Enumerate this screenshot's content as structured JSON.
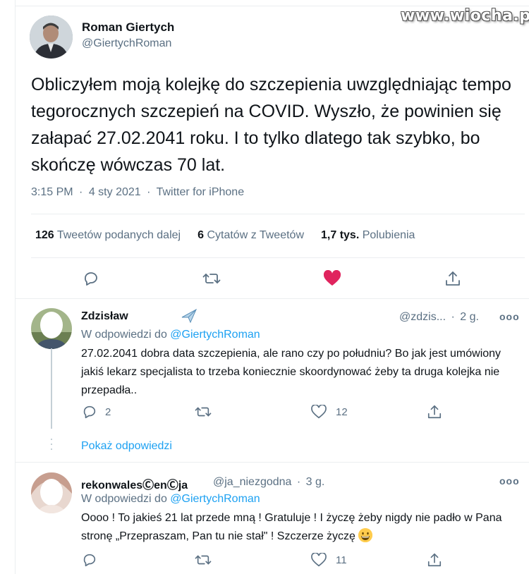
{
  "watermark": "www.wiocha.pl",
  "tweet": {
    "author_name": "Roman Giertych",
    "author_handle": "@GiertychRoman",
    "text": "Obliczyłem moją kolejkę do szczepienia uwzględniając tempo tegorocznych szczepień na COVID. Wyszło, że powinien się załapać 27.02.2041 roku. I to tylko dlatego tak szybko, bo skończę wówczas 70 lat.",
    "time": "3:15 PM",
    "date": "4 sty 2021",
    "source": "Twitter for iPhone",
    "stats": {
      "retweets_count": "126",
      "retweets_label": "Tweetów podanych dalej",
      "quotes_count": "6",
      "quotes_label": "Cytatów z Tweetów",
      "likes_count": "1,7 tys.",
      "likes_label": "Polubienia"
    }
  },
  "replies": [
    {
      "name": "Zdzisław",
      "name_emoji": "✈️",
      "handle": "@zdzis...",
      "age": "2 g.",
      "reply_to_prefix": "W odpowiedzi do",
      "reply_to_handle": "@GiertychRoman",
      "text": "27.02.2041 dobra data szczepienia, ale rano czy po południu? Bo jak jest umówiony jakiś lekarz specjalista to trzeba koniecznie skoordynować żeby ta druga kolejka nie przepadła..",
      "reply_count": "2",
      "retweet_count": "",
      "like_count": "12"
    },
    {
      "name": "rekonwalesⒸenⒸja",
      "handle": "@ja_niezgodna",
      "age": "3 g.",
      "reply_to_prefix": "W odpowiedzi do",
      "reply_to_handle": "@GiertychRoman",
      "text": "Oooo ! To jakieś 21 lat przede mną ! Gratuluje ! I życzę żeby nigdy nie padło w Pana stronę „Przepraszam, Pan tu nie stał\" ! Szczerze życzę",
      "reply_count": "",
      "retweet_count": "",
      "like_count": "11"
    }
  ],
  "show_replies": "Pokaż odpowiedzi",
  "separator": "·",
  "more": "ooo",
  "colors": {
    "accent": "#1da1f2",
    "like": "#e0245e",
    "secondary_text": "#5b7083"
  },
  "icons": [
    "reply-icon",
    "retweet-icon",
    "heart-icon",
    "share-icon",
    "airplane-icon",
    "more-icon",
    "grinning-emoji"
  ]
}
